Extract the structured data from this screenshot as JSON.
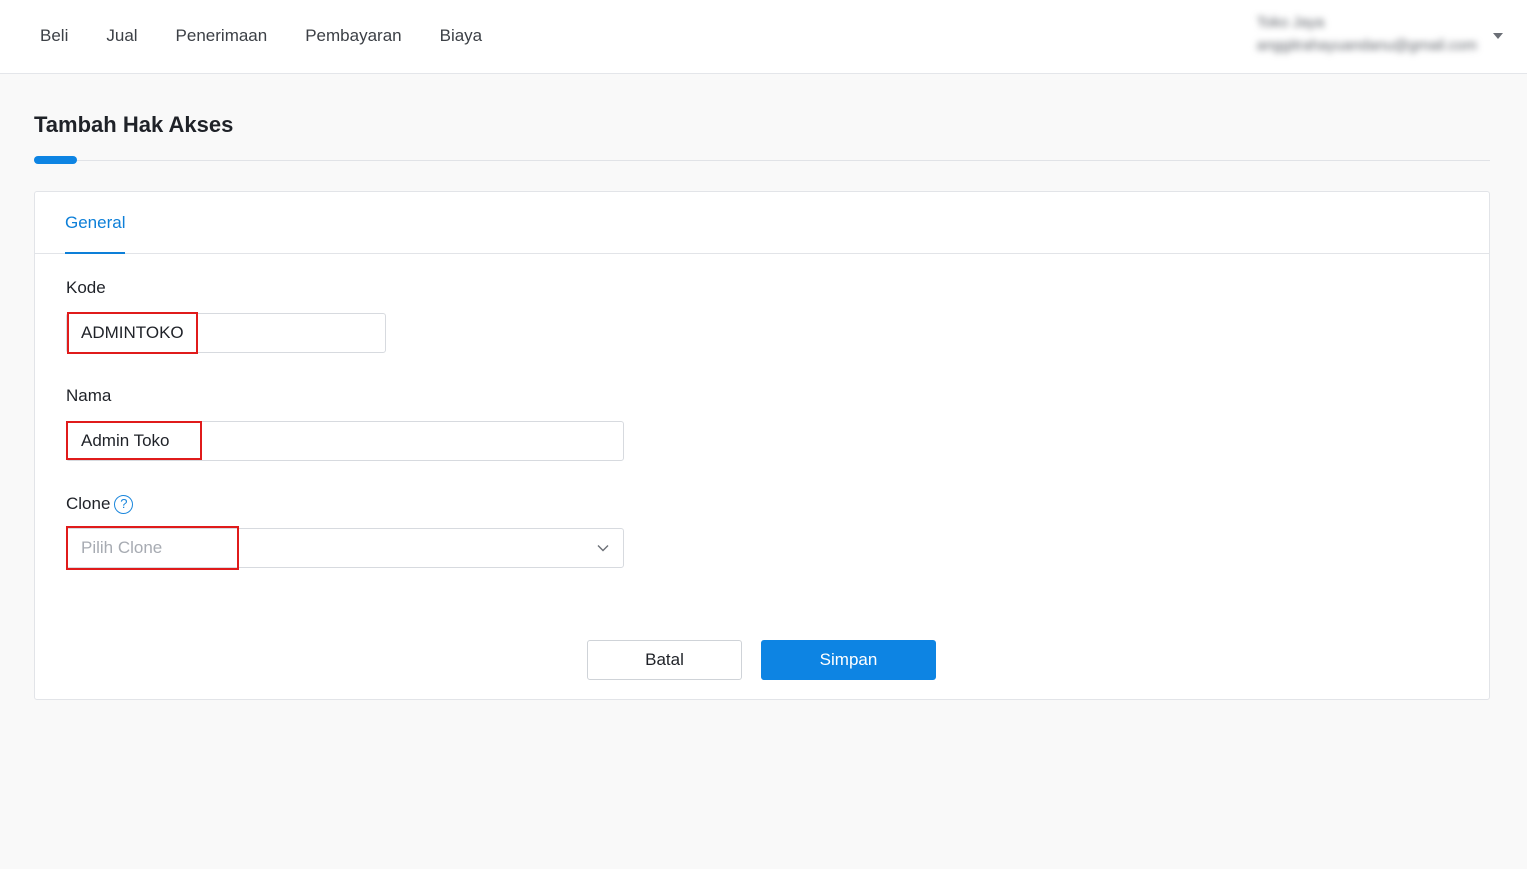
{
  "nav": {
    "items": [
      {
        "label": "Beli"
      },
      {
        "label": "Jual"
      },
      {
        "label": "Penerimaan"
      },
      {
        "label": "Pembayaran"
      },
      {
        "label": "Biaya"
      }
    ]
  },
  "user": {
    "name": "Toko Jaya",
    "email": "anggitrahayuandanu@gmail.com"
  },
  "page": {
    "title": "Tambah Hak Akses"
  },
  "tabs": [
    {
      "label": "General"
    }
  ],
  "form": {
    "kode": {
      "label": "Kode",
      "value": "ADMINTOKO"
    },
    "nama": {
      "label": "Nama",
      "value": "Admin Toko"
    },
    "clone": {
      "label": "Clone",
      "placeholder": "Pilih Clone",
      "help_glyph": "?"
    }
  },
  "buttons": {
    "cancel": "Batal",
    "save": "Simpan"
  },
  "colors": {
    "accent": "#0d84e3",
    "highlight": "#e01b1b"
  }
}
